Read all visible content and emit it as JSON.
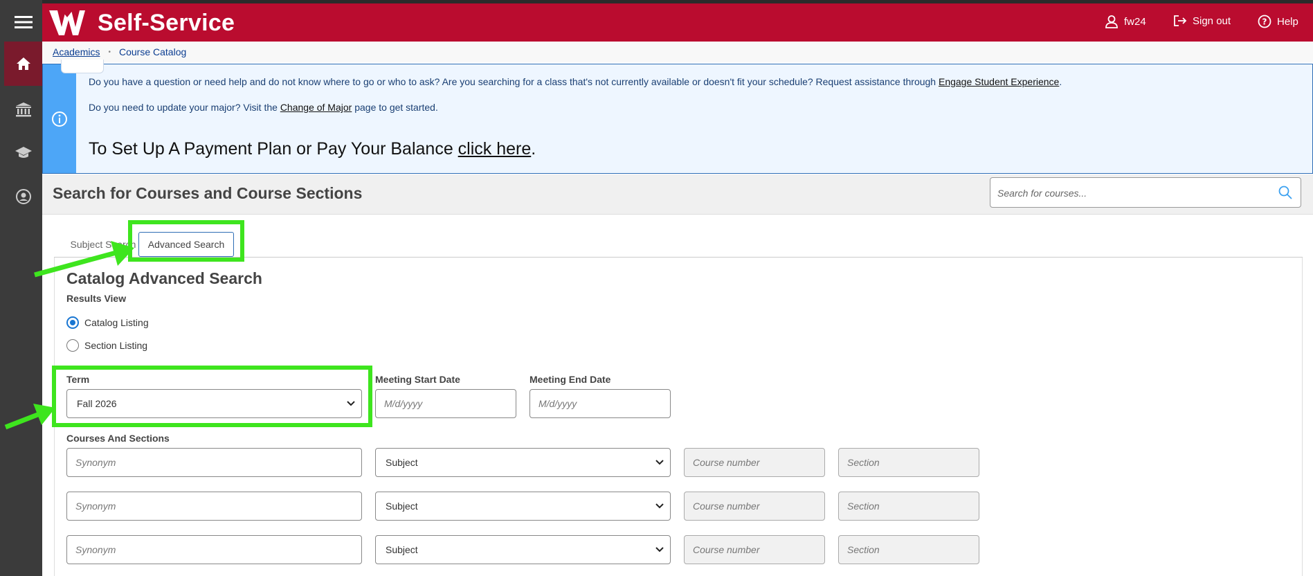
{
  "header": {
    "app_title": "Self-Service",
    "user": "fw24",
    "sign_out": "Sign out",
    "help": "Help"
  },
  "breadcrumb": {
    "items": [
      "Academics",
      "Course Catalog"
    ]
  },
  "alert": {
    "line1_text": "Do you have a question or need help and do not know where to go or who to ask? Are you searching for a class that's not currently available or doesn't fit your schedule? Request assistance through ",
    "line1_link": "Engage Student Experience",
    "line1_end": ".",
    "line2_text": "Do you need to update your major? Visit the ",
    "line2_link": "Change of Major",
    "line2_end": " page to get started.",
    "big_text": "To Set Up A Payment Plan or Pay Your Balance ",
    "big_link": "click here",
    "big_end": "."
  },
  "page": {
    "title": "Search for Courses and Course Sections",
    "search_placeholder": "Search for courses..."
  },
  "tabs": {
    "subject": "Subject Search",
    "advanced": "Advanced Search"
  },
  "form": {
    "title": "Catalog Advanced Search",
    "results_view_label": "Results View",
    "results_options": [
      "Catalog Listing",
      "Section Listing"
    ],
    "selected_result": "Catalog Listing",
    "term_label": "Term",
    "term_value": "Fall 2026",
    "start_date_label": "Meeting Start Date",
    "end_date_label": "Meeting End Date",
    "date_placeholder": "M/d/yyyy",
    "courses_label": "Courses And Sections",
    "rows": [
      {
        "synonym_placeholder": "Synonym",
        "subject": "Subject",
        "course_placeholder": "Course number",
        "section_placeholder": "Section"
      },
      {
        "synonym_placeholder": "Synonym",
        "subject": "Subject",
        "course_placeholder": "Course number",
        "section_placeholder": "Section"
      },
      {
        "synonym_placeholder": "Synonym",
        "subject": "Subject",
        "course_placeholder": "Course number",
        "section_placeholder": "Section"
      }
    ]
  },
  "colors": {
    "brand": "#ba0c2f",
    "nav": "#3b3b3b",
    "alert_bar": "#4da6f7",
    "annotation": "#3ee51e"
  }
}
